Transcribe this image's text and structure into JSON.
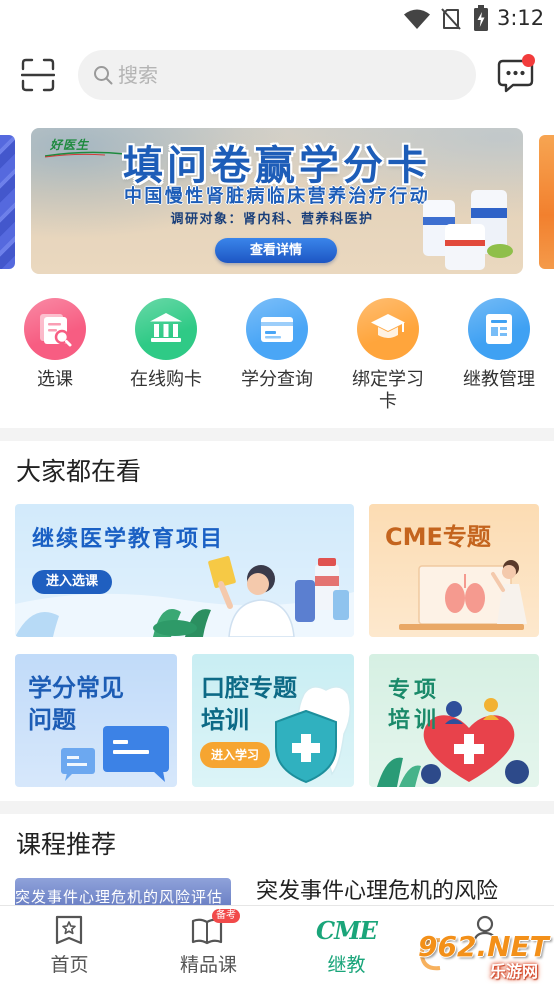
{
  "status_bar": {
    "time": "3:12",
    "icons": [
      "wifi-icon",
      "no-signal-icon",
      "battery-charging-icon"
    ]
  },
  "header": {
    "scan_icon": "scan-icon",
    "search_icon": "search-icon",
    "search_placeholder": "搜索",
    "message_icon": "message-icon",
    "message_unread": true,
    "unread_color": "#f23c3c"
  },
  "banner": {
    "logo_text": "好医生",
    "title": "填问卷赢学分卡",
    "subtitle": "中国慢性肾脏病临床营养治疗行动",
    "target": "调研对象：肾内科、营养科医护",
    "button": "查看详情",
    "accent": "#1d5db8"
  },
  "quick_actions": [
    {
      "label": "选课",
      "icon": "course-select-icon",
      "color": "#f75d82"
    },
    {
      "label": "在线购卡",
      "icon": "bank-icon",
      "color": "#2fca86"
    },
    {
      "label": "学分查询",
      "icon": "credit-card-icon",
      "color": "#4aa6f6"
    },
    {
      "label": "绑定学习卡",
      "icon": "graduation-cap-icon",
      "color": "#ffa53c"
    },
    {
      "label": "继教管理",
      "icon": "document-icon",
      "color": "#3fa1f3"
    }
  ],
  "popular": {
    "title": "大家都在看",
    "cards": [
      {
        "title": "继续医学教育项目",
        "button": "进入选课",
        "color": "#d2eafb",
        "title_color": "#1a60c4",
        "button_color": "#1f5fc0"
      },
      {
        "title": "CME专题",
        "color": "#fcdcb3",
        "title_color": "#c4641e"
      },
      {
        "title": "学分常见问题",
        "color": "#c1dbf9",
        "title_color": "#1d5db5"
      },
      {
        "title": "口腔专题培训",
        "button": "进入学习",
        "color": "#c9eef3",
        "title_color": "#0d6a86",
        "button_color": "#f6a531"
      },
      {
        "title": "专项培训",
        "color": "#d6f0e3",
        "title_color": "#1b8a6a"
      }
    ]
  },
  "recommend": {
    "title": "课程推荐",
    "courses": [
      {
        "thumb_text": "突发事件心理危机的风险评估",
        "title": "突发事件心理危机的风险"
      }
    ]
  },
  "tabbar": {
    "active_index": 2,
    "active_color": "#1aa57a",
    "items": [
      {
        "label": "首页",
        "icon": "home-icon"
      },
      {
        "label": "精品课",
        "icon": "book-icon",
        "badge": "备考"
      },
      {
        "label": "继教",
        "icon": "cme-icon",
        "icon_text": "CME"
      },
      {
        "icon": "profile-icon"
      }
    ]
  },
  "watermark": {
    "brand": "962.NET",
    "name": "乐游网"
  }
}
